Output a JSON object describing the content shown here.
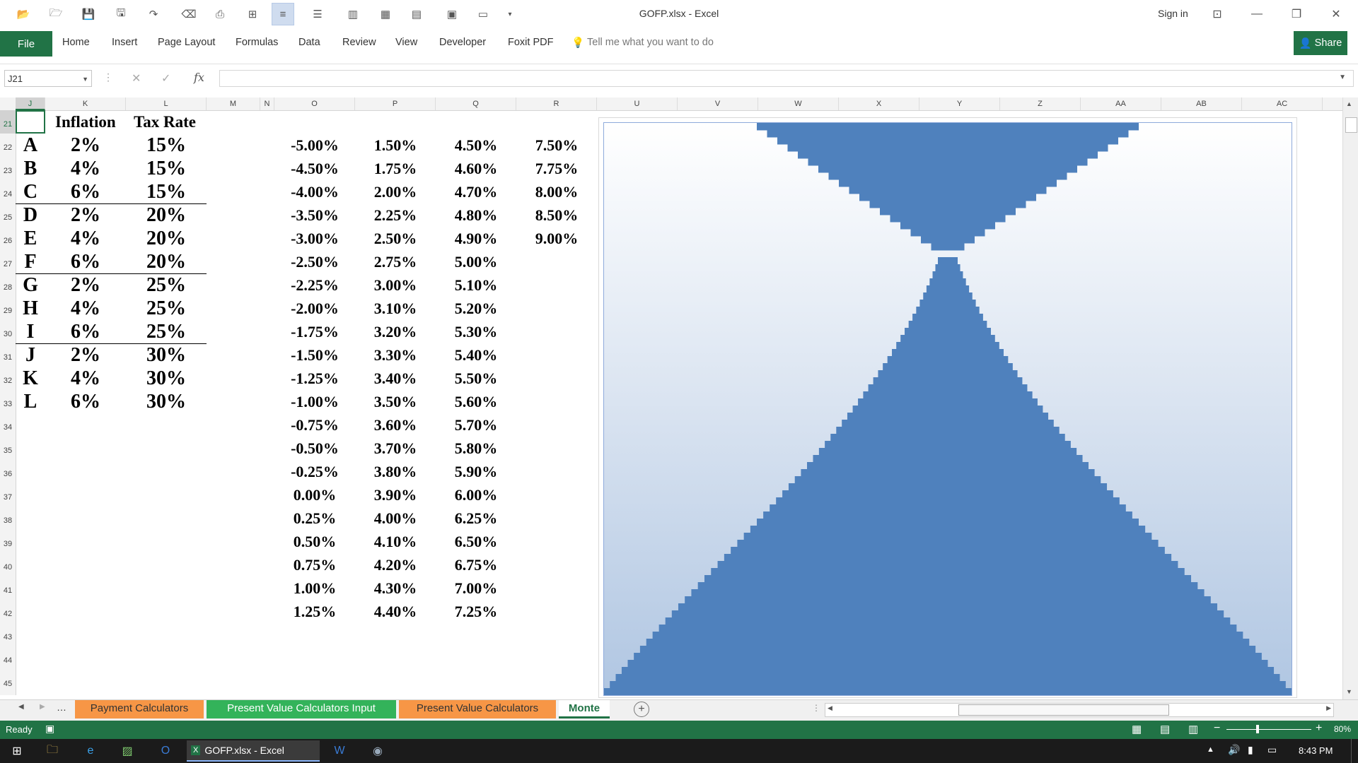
{
  "window": {
    "title": "GOFP.xlsx - Excel",
    "sign_in": "Sign in"
  },
  "ribbon": {
    "file": "File",
    "tabs": [
      "Home",
      "Insert",
      "Page Layout",
      "Formulas",
      "Data",
      "Review",
      "View",
      "Developer",
      "Foxit PDF"
    ],
    "tell_me": "Tell me what you want to do",
    "share": "Share"
  },
  "formula_bar": {
    "name_box": "J21",
    "formula": ""
  },
  "columns": [
    "J",
    "K",
    "L",
    "M",
    "N",
    "O",
    "P",
    "Q",
    "R",
    "U",
    "V",
    "W",
    "X",
    "Y",
    "Z",
    "AA",
    "AB",
    "AC"
  ],
  "rows": [
    "21",
    "22",
    "23",
    "24",
    "25",
    "26",
    "27",
    "28",
    "29",
    "30",
    "31",
    "32",
    "33",
    "34",
    "35",
    "36",
    "37",
    "38",
    "39",
    "40",
    "41",
    "42",
    "43",
    "44",
    "45"
  ],
  "table": {
    "header": {
      "inflation": "Inflation",
      "tax_rate": "Tax Rate"
    },
    "rows": [
      {
        "letter": "A",
        "inflation": "2%",
        "tax": "15%"
      },
      {
        "letter": "B",
        "inflation": "4%",
        "tax": "15%"
      },
      {
        "letter": "C",
        "inflation": "6%",
        "tax": "15%"
      },
      {
        "letter": "D",
        "inflation": "2%",
        "tax": "20%"
      },
      {
        "letter": "E",
        "inflation": "4%",
        "tax": "20%"
      },
      {
        "letter": "F",
        "inflation": "6%",
        "tax": "20%"
      },
      {
        "letter": "G",
        "inflation": "2%",
        "tax": "25%"
      },
      {
        "letter": "H",
        "inflation": "4%",
        "tax": "25%"
      },
      {
        "letter": "I",
        "inflation": "6%",
        "tax": "25%"
      },
      {
        "letter": "J",
        "inflation": "2%",
        "tax": "30%"
      },
      {
        "letter": "K",
        "inflation": "4%",
        "tax": "30%"
      },
      {
        "letter": "L",
        "inflation": "6%",
        "tax": "30%"
      }
    ]
  },
  "rates": {
    "O": [
      "-5.00%",
      "-4.50%",
      "-4.00%",
      "-3.50%",
      "-3.00%",
      "-2.50%",
      "-2.25%",
      "-2.00%",
      "-1.75%",
      "-1.50%",
      "-1.25%",
      "-1.00%",
      "-0.75%",
      "-0.50%",
      "-0.25%",
      "0.00%",
      "0.25%",
      "0.50%",
      "0.75%",
      "1.00%",
      "1.25%"
    ],
    "P": [
      "1.50%",
      "1.75%",
      "2.00%",
      "2.25%",
      "2.50%",
      "2.75%",
      "3.00%",
      "3.10%",
      "3.20%",
      "3.30%",
      "3.40%",
      "3.50%",
      "3.60%",
      "3.70%",
      "3.80%",
      "3.90%",
      "4.00%",
      "4.10%",
      "4.20%",
      "4.30%",
      "4.40%"
    ],
    "Q": [
      "4.50%",
      "4.60%",
      "4.70%",
      "4.80%",
      "4.90%",
      "5.00%",
      "5.10%",
      "5.20%",
      "5.30%",
      "5.40%",
      "5.50%",
      "5.60%",
      "5.70%",
      "5.80%",
      "5.90%",
      "6.00%",
      "6.25%",
      "6.50%",
      "6.75%",
      "7.00%",
      "7.25%"
    ],
    "R": [
      "7.50%",
      "7.75%",
      "8.00%",
      "8.50%",
      "9.00%"
    ]
  },
  "chart_data": {
    "type": "area",
    "fill_color": "#4f81bd",
    "background": "gradient #ffffff to #b0c6e2",
    "shape": "hourglass"
  },
  "sheet_tabs": [
    {
      "label": "Payment Calculators",
      "color": "#f79646",
      "active": false
    },
    {
      "label": "Present Value Calculators Input",
      "color": "#33b35a",
      "active": false
    },
    {
      "label": "Present Value Calculators",
      "color": "#f79646",
      "active": false
    },
    {
      "label": "Monte",
      "color": "#ffffff",
      "active": true
    }
  ],
  "status": {
    "ready": "Ready",
    "zoom": "80%"
  },
  "taskbar": {
    "excel_window": "GOFP.xlsx - Excel",
    "time": "8:43 PM"
  },
  "colors": {
    "excel_green": "#217346",
    "chart_blue": "#4f81bd"
  }
}
